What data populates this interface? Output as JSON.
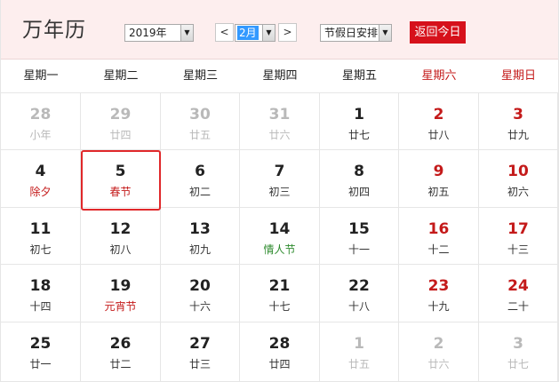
{
  "header": {
    "title": "万年历",
    "year_value": "2019年",
    "month_value": "2月",
    "holiday_value": "节假日安排",
    "prev_label": "<",
    "next_label": ">",
    "today_label": "返回今日"
  },
  "colors": {
    "accent": "#d6111b",
    "weekend": "#c41a1a",
    "festival": "#2e8b2e",
    "header_bg": "#fdeeee"
  },
  "icons": {
    "dropdown": "chevron-down-icon"
  },
  "weekdays": [
    {
      "label": "星期一",
      "weekend": false
    },
    {
      "label": "星期二",
      "weekend": false
    },
    {
      "label": "星期三",
      "weekend": false
    },
    {
      "label": "星期四",
      "weekend": false
    },
    {
      "label": "星期五",
      "weekend": false
    },
    {
      "label": "星期六",
      "weekend": true
    },
    {
      "label": "星期日",
      "weekend": true
    }
  ],
  "weeks": [
    [
      {
        "day": "28",
        "lunar": "小年",
        "other": true
      },
      {
        "day": "29",
        "lunar": "廿四",
        "other": true
      },
      {
        "day": "30",
        "lunar": "廿五",
        "other": true
      },
      {
        "day": "31",
        "lunar": "廿六",
        "other": true
      },
      {
        "day": "1",
        "lunar": "廿七"
      },
      {
        "day": "2",
        "lunar": "廿八",
        "weekend": true
      },
      {
        "day": "3",
        "lunar": "廿九",
        "weekend": true
      }
    ],
    [
      {
        "day": "4",
        "lunar": "除夕",
        "holiday": true
      },
      {
        "day": "5",
        "lunar": "春节",
        "holiday": true,
        "selected": true
      },
      {
        "day": "6",
        "lunar": "初二"
      },
      {
        "day": "7",
        "lunar": "初三"
      },
      {
        "day": "8",
        "lunar": "初四"
      },
      {
        "day": "9",
        "lunar": "初五",
        "weekend": true
      },
      {
        "day": "10",
        "lunar": "初六",
        "weekend": true
      }
    ],
    [
      {
        "day": "11",
        "lunar": "初七"
      },
      {
        "day": "12",
        "lunar": "初八"
      },
      {
        "day": "13",
        "lunar": "初九"
      },
      {
        "day": "14",
        "lunar": "情人节",
        "festival": true
      },
      {
        "day": "15",
        "lunar": "十一"
      },
      {
        "day": "16",
        "lunar": "十二",
        "weekend": true
      },
      {
        "day": "17",
        "lunar": "十三",
        "weekend": true
      }
    ],
    [
      {
        "day": "18",
        "lunar": "十四"
      },
      {
        "day": "19",
        "lunar": "元宵节",
        "holiday": true
      },
      {
        "day": "20",
        "lunar": "十六"
      },
      {
        "day": "21",
        "lunar": "十七"
      },
      {
        "day": "22",
        "lunar": "十八"
      },
      {
        "day": "23",
        "lunar": "十九",
        "weekend": true
      },
      {
        "day": "24",
        "lunar": "二十",
        "weekend": true
      }
    ],
    [
      {
        "day": "25",
        "lunar": "廿一"
      },
      {
        "day": "26",
        "lunar": "廿二"
      },
      {
        "day": "27",
        "lunar": "廿三"
      },
      {
        "day": "28",
        "lunar": "廿四"
      },
      {
        "day": "1",
        "lunar": "廿五",
        "other": true
      },
      {
        "day": "2",
        "lunar": "廿六",
        "other": true
      },
      {
        "day": "3",
        "lunar": "廿七",
        "other": true
      }
    ]
  ]
}
